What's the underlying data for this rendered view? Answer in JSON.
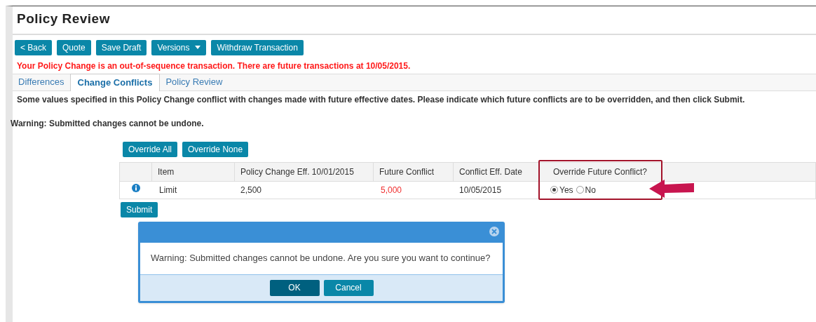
{
  "page": {
    "title": "Policy Review"
  },
  "toolbar": [
    {
      "label": "< Back",
      "kind": "plain"
    },
    {
      "label": "Quote",
      "kind": "plain"
    },
    {
      "label": "Save Draft",
      "kind": "plain"
    },
    {
      "label": "Versions",
      "kind": "dropdown"
    },
    {
      "label": "Withdraw Transaction",
      "kind": "plain"
    }
  ],
  "alert": "Your Policy Change is an out-of-sequence transaction. There are future transactions at 10/05/2015.",
  "tabs": [
    {
      "label": "Differences",
      "selected": false
    },
    {
      "label": "Change Conflicts",
      "selected": true
    },
    {
      "label": "Policy Review",
      "selected": false
    }
  ],
  "instructions": "Some values specified in this Policy Change conflict with changes made with future effective dates. Please indicate which future conflicts are to be overridden, and then click Submit.",
  "warning": "Warning: Submitted changes cannot be undone.",
  "override_buttons": [
    "Override All",
    "Override None"
  ],
  "table": {
    "columns": [
      "Item",
      "Policy Change Eff. 10/01/2015",
      "Future Conflict",
      "Conflict Eff. Date",
      "Override Future Conflict?"
    ],
    "rows": [
      {
        "item": "Limit",
        "policy_change": "2,500",
        "future_conflict": "5,000",
        "conflict_date": "10/05/2015",
        "options": [
          {
            "label": "Yes",
            "selected": true
          },
          {
            "label": "No",
            "selected": false
          }
        ]
      }
    ]
  },
  "submit": "Submit",
  "dialog": {
    "message": "Warning: Submitted changes cannot be undone. Are you sure you want to continue?",
    "buttons": [
      {
        "label": "OK",
        "kind": "primary"
      },
      {
        "label": "Cancel",
        "kind": "secondary"
      }
    ]
  }
}
